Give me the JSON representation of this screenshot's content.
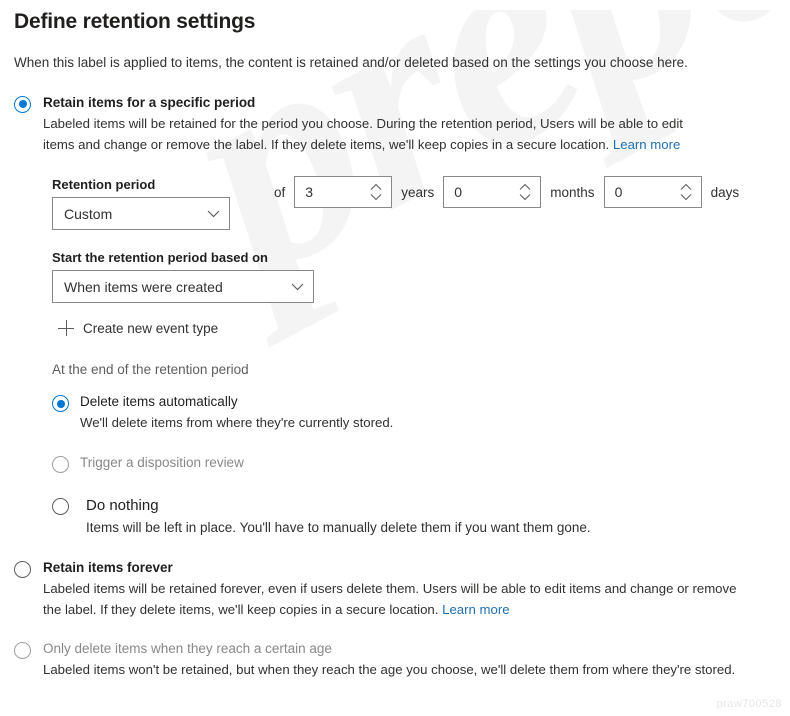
{
  "page": {
    "title": "Define retention settings",
    "intro": "When this label is applied to items, the content is retained and/or deleted based on the settings you choose here.",
    "watermark": "prepaway",
    "watermark_corner": "praw700528"
  },
  "colors": {
    "accent": "#0078d4",
    "link": "#1f6fb2",
    "text": "#323130",
    "muted_text": "#8a8886",
    "border": "#8a8886"
  },
  "options": {
    "retain_specific": {
      "label": "Retain items for a specific period",
      "selected": true,
      "description": "Labeled items will be retained for the period you choose. During the retention period, Users will be able to edit items and change or remove the label. If they delete items, we'll keep copies in a secure location.",
      "learn_more": "Learn more"
    },
    "retain_forever": {
      "label": "Retain items forever",
      "selected": false,
      "description": "Labeled items will be retained forever, even if users delete them. Users will be able to edit items and change or remove the label. If they delete items, we'll keep copies in a secure location.",
      "learn_more": "Learn more"
    },
    "only_delete": {
      "label": "Only delete items when they reach a certain age",
      "selected": false,
      "description": "Labeled items won't be retained, but when they reach the age you choose, we'll delete them from where they're stored."
    }
  },
  "retention_period": {
    "label": "Retention period",
    "dropdown_value": "Custom",
    "of_label": "of",
    "years": {
      "value": "3",
      "unit": "years"
    },
    "months": {
      "value": "0",
      "unit": "months"
    },
    "days": {
      "value": "0",
      "unit": "days"
    }
  },
  "start_period": {
    "label": "Start the retention period based on",
    "dropdown_value": "When items were created"
  },
  "create_event": {
    "label": "Create new event type"
  },
  "end_of_period": {
    "heading": "At the end of the retention period",
    "choices": [
      {
        "label": "Delete items automatically",
        "selected": true,
        "disabled": false,
        "description": "We'll delete items from where they're currently stored."
      },
      {
        "label": "Trigger a disposition review",
        "selected": false,
        "disabled": true,
        "description": ""
      },
      {
        "label": "Do nothing",
        "selected": false,
        "disabled": false,
        "description": "Items will be left in place. You'll have to manually delete them if you want them gone."
      }
    ]
  }
}
